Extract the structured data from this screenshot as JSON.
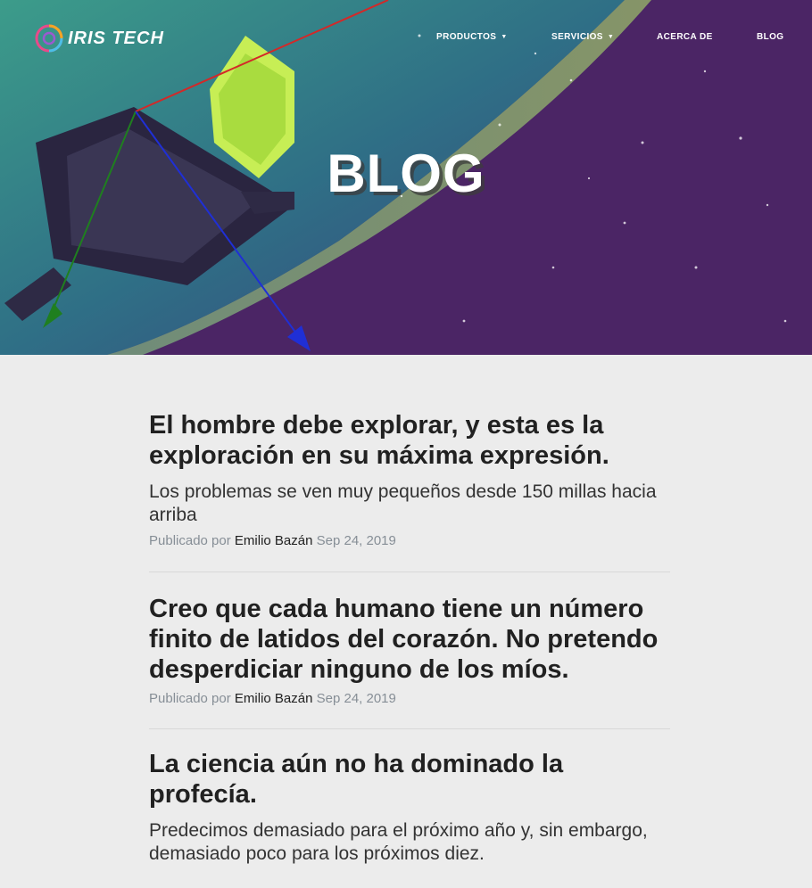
{
  "brand": {
    "name": "IRIS TECH",
    "logo_icon": "iris-swirl-logo"
  },
  "nav": {
    "items": [
      {
        "label": "PRODUCTOS",
        "has_dropdown": true
      },
      {
        "label": "SERVICIOS",
        "has_dropdown": true
      },
      {
        "label": "ACERCA DE",
        "has_dropdown": false
      },
      {
        "label": "BLOG",
        "has_dropdown": false
      }
    ]
  },
  "hero": {
    "title": "BLOG"
  },
  "posts": [
    {
      "title": "El hombre debe explorar, y esta es la exploración en su máxima expresión.",
      "subtitle": "Los problemas se ven muy pequeños desde 150 millas hacia arriba",
      "meta_prefix": "Publicado por",
      "author": "Emilio Bazán",
      "date": "Sep 24, 2019"
    },
    {
      "title": "Creo que cada humano tiene un número finito de latidos del corazón. No pretendo desperdiciar ninguno de los míos.",
      "meta_prefix": "Publicado por",
      "author": "Emilio Bazán",
      "date": "Sep 24, 2019"
    },
    {
      "title": "La ciencia aún no ha dominado la profecía.",
      "subtitle": "Predecimos demasiado para el próximo año y, sin embargo, demasiado poco para los próximos diez."
    }
  ],
  "colors": {
    "hero_purple": "#4a2463",
    "hero_teal": "#3b8b8c",
    "page_background": "#ececec",
    "text": "#212121",
    "meta": "#868e96"
  }
}
